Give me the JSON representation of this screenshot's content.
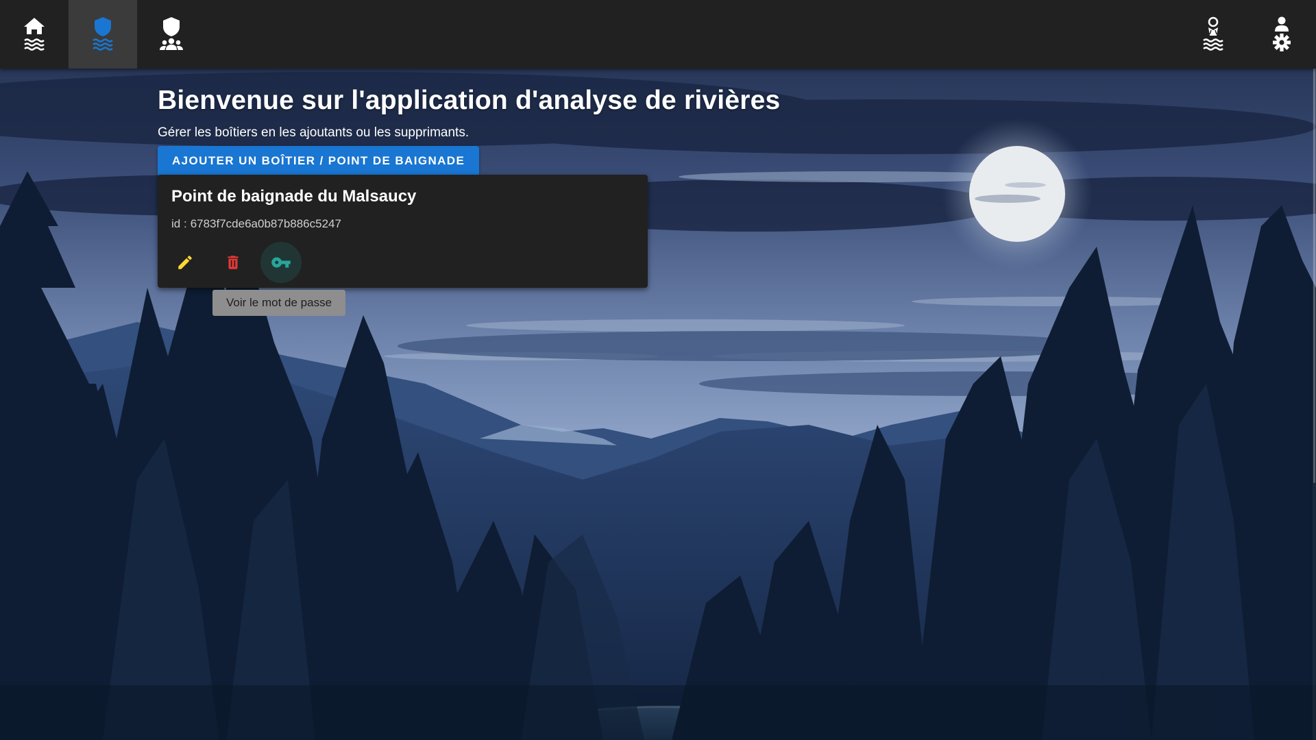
{
  "nav": {
    "left": [
      {
        "id": "home",
        "icon": "home-waves-icon",
        "active": false
      },
      {
        "id": "boxes",
        "icon": "shield-waves-icon",
        "active": true
      },
      {
        "id": "users",
        "icon": "shield-users-icon",
        "active": false
      }
    ],
    "right": [
      {
        "id": "river-analysis",
        "icon": "person-waves-icon"
      },
      {
        "id": "account-settings",
        "icon": "user-gear-icon"
      }
    ]
  },
  "main": {
    "title": "Bienvenue sur l'application d'analyse de rivières",
    "subtitle": "Gérer les boîtiers en les ajoutants ou les supprimants.",
    "add_button_label": "Ajouter un boîtier / point de baignade"
  },
  "cards": [
    {
      "name": "Point de baignade du Malsaucy",
      "id_label": "id :",
      "id_value": "6783f7cde6a0b87b886c5247",
      "actions": [
        {
          "icon": "pencil-icon",
          "color": "#fdd835"
        },
        {
          "icon": "trash-icon",
          "color": "#e53935"
        },
        {
          "icon": "key-icon",
          "color": "#26a69a",
          "focused": true
        }
      ]
    }
  ],
  "tooltip": {
    "text": "Voir le mot de passe"
  },
  "colors": {
    "topbar": "#212121",
    "active_nav": "#3b3b3b",
    "primary": "#1976d2",
    "active_icon": "#1976d2",
    "card_bg": "#212121",
    "edit": "#fdd835",
    "delete": "#e53935",
    "key": "#26a69a"
  }
}
